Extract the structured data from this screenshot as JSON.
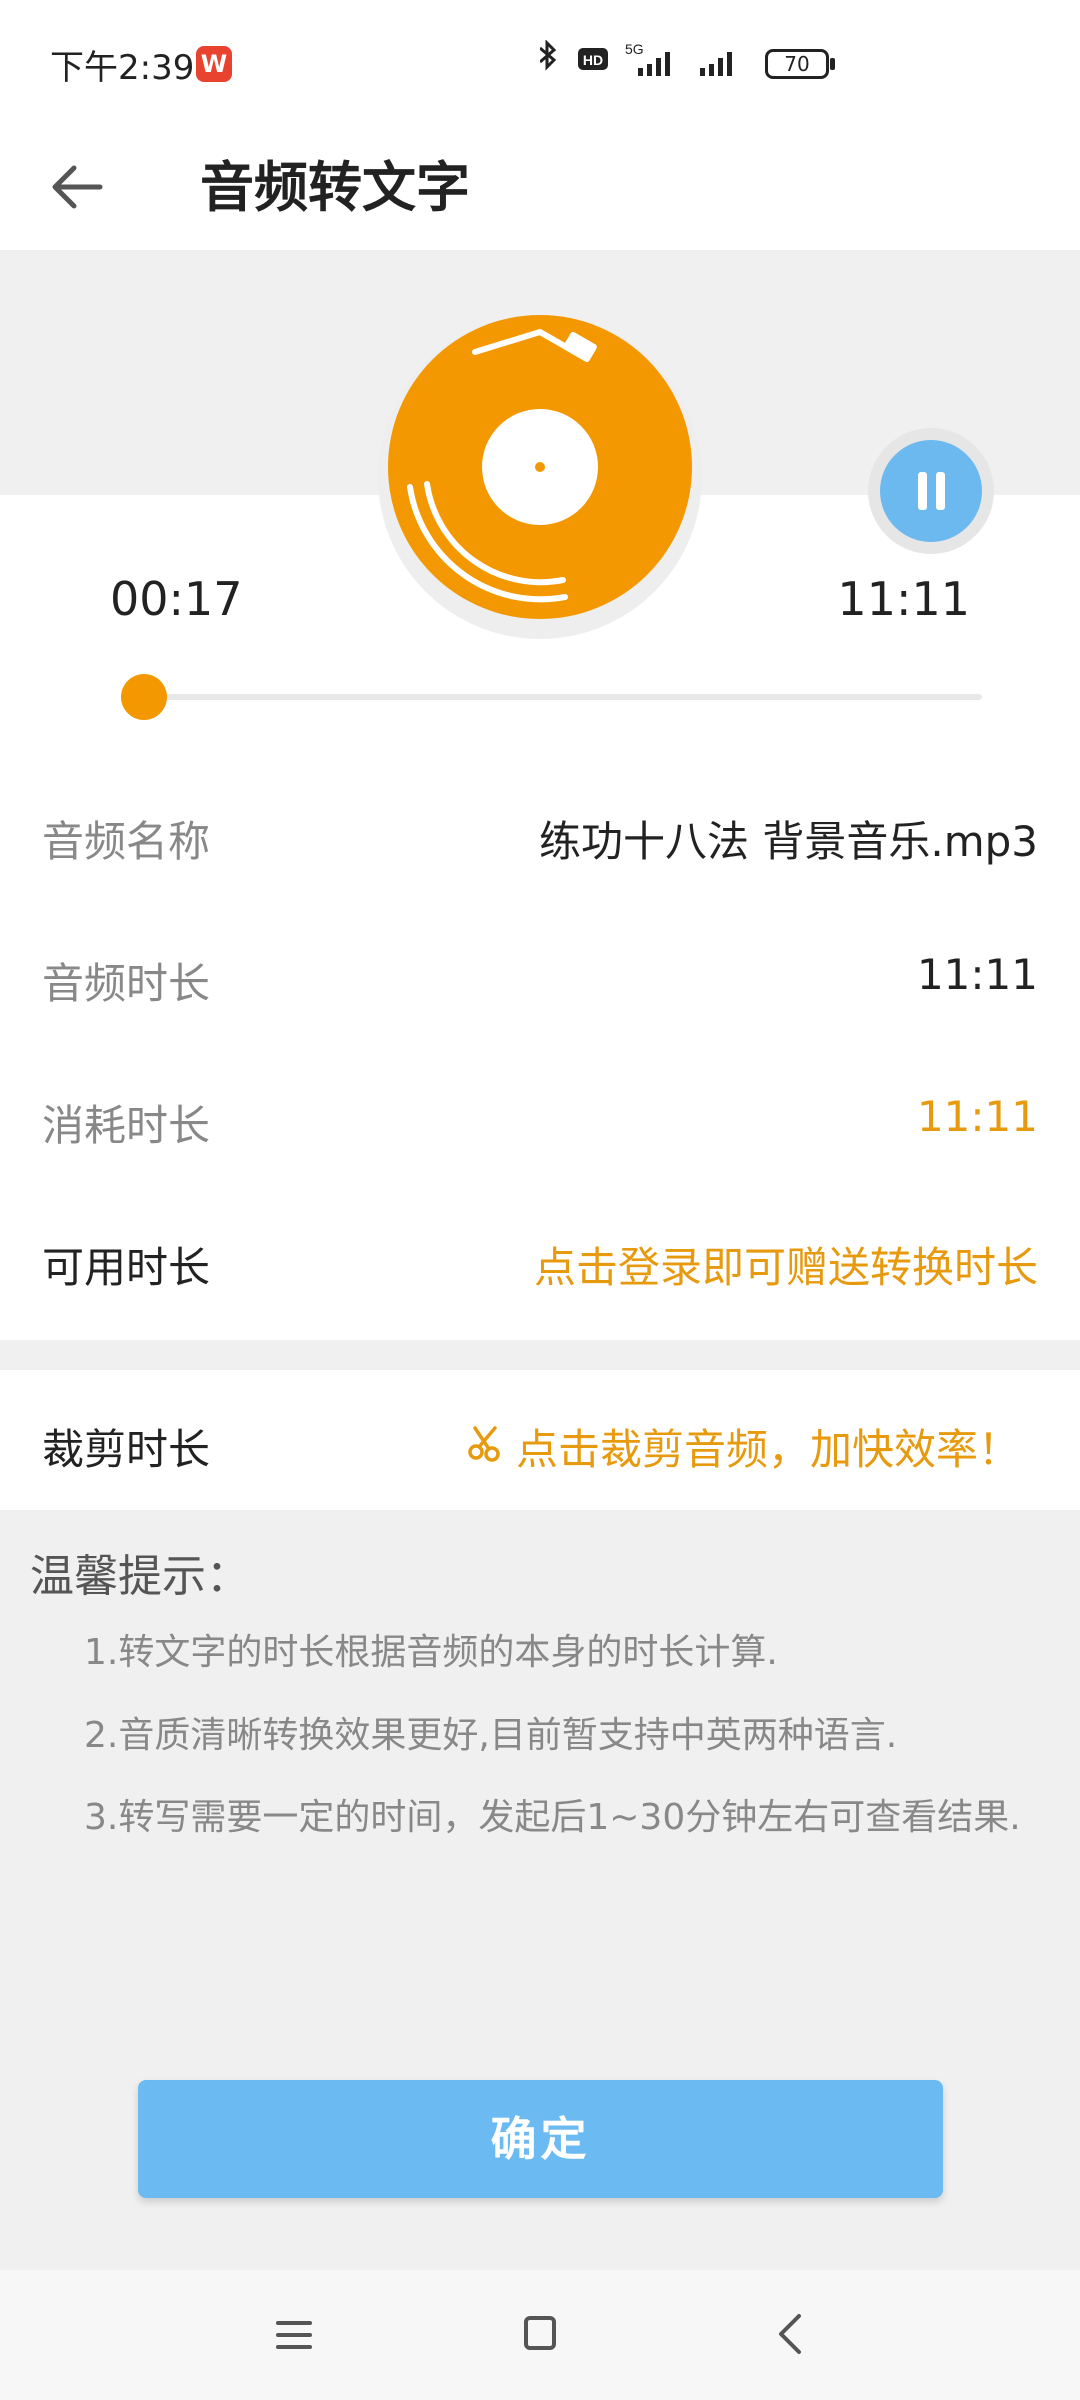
{
  "status_bar": {
    "time": "下午2:39",
    "app_badge": "W",
    "signal": "5G",
    "hd": "HD",
    "battery": "70"
  },
  "header": {
    "title": "音频转文字"
  },
  "player": {
    "current_time": "00:17",
    "total_time": "11:11",
    "progress": 0.025,
    "accent_color": "#f39800",
    "pause_color": "#6cb9f0"
  },
  "info": {
    "rows": [
      {
        "label": "音频名称",
        "value": "练功十八法 背景音乐.mp3"
      },
      {
        "label": "音频时长",
        "value": "11:11"
      },
      {
        "label": "消耗时长",
        "value": "11:11"
      },
      {
        "label": "可用时长",
        "value": "点击登录即可赠送转换时长"
      }
    ]
  },
  "trim": {
    "label": "裁剪时长",
    "value": "点击裁剪音频，加快效率！"
  },
  "tips": {
    "title": "温馨提示：",
    "items": [
      "1.转文字的时长根据音频的本身的时长计算.",
      "2.音质清晰转换效果更好,目前暂支持中英两种语言.",
      "3.转写需要一定的时间，发起后1~30分钟左右可查看结果."
    ]
  },
  "confirm_button": "确定"
}
